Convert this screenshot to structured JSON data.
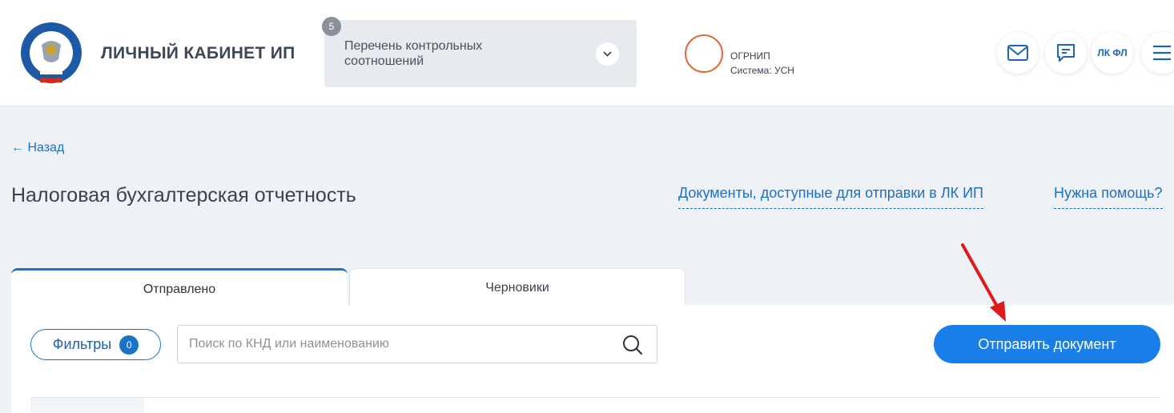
{
  "header": {
    "brand": "ЛИЧНЫЙ КАБИНЕТ ИП",
    "notification": {
      "count": "5",
      "text": "Перечень контрольных соотношений"
    },
    "user": {
      "ogrnip_label": "ОГРНИП",
      "system": "Система: УСН"
    },
    "lk_fl_label": "ЛК ФЛ",
    "icons": [
      "mail-icon",
      "chat-icon",
      "menu-icon"
    ]
  },
  "nav": {
    "back": "← Назад"
  },
  "page": {
    "title": "Налоговая бухгалтерская отчетность",
    "links": {
      "docs": "Документы, доступные для отправки в ЛК ИП",
      "help": "Нужна помощь?"
    }
  },
  "tabs": [
    {
      "label": "Отправлено",
      "active": true
    },
    {
      "label": "Черновики",
      "active": false
    }
  ],
  "toolbar": {
    "filters_label": "Фильтры",
    "filters_count": "0",
    "search_placeholder": "Поиск по КНД или наименованию",
    "send_label": "Отправить документ"
  },
  "colors": {
    "accent": "#1a7ee8",
    "link": "#1f6fc1",
    "user_ring": "#e0683b",
    "arrow": "#e01b1b"
  }
}
